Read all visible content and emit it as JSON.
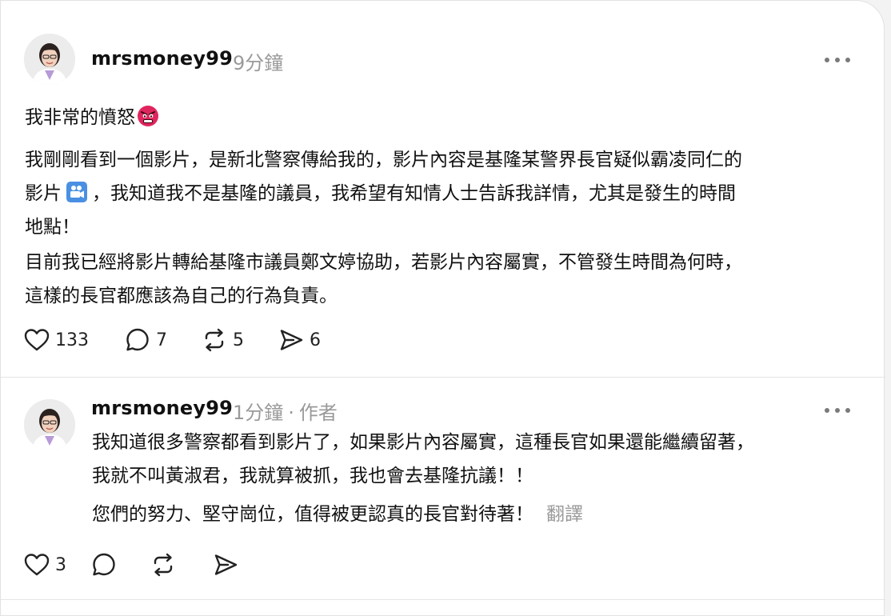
{
  "posts": [
    {
      "username": "mrsmoney99",
      "time": "9分鐘",
      "paragraphs": [
        "我非常的憤怒",
        "我剛剛看到一個影片，是新北警察傳給我的，影片內容是基隆某警界長官疑似霸凌同仁的",
        "影片",
        "，我知道我不是基隆的議員，我希望有知情人士告訴我詳情，尤其是發生的時間",
        "地點！",
        "目前我已經將影片轉給基隆市議員鄭文婷協助，若影片內容屬實，不管發生時間為何時，",
        "這樣的長官都應該為自己的行為負責。"
      ],
      "likes": "133",
      "replies": "7",
      "reposts": "5",
      "shares": "6"
    },
    {
      "username": "mrsmoney99",
      "time": "1分鐘",
      "separator": "·",
      "author_badge": "作者",
      "paragraphs": [
        "我知道很多警察都看到影片了，如果影片內容屬實，這種長官如果還能繼續留著，",
        "我就不叫黃淑君，我就算被抓，我也會去基隆抗議！！",
        "您們的努力、堅守崗位，值得被更認真的長官對待著！"
      ],
      "translate_label": "翻譯",
      "likes": "3"
    }
  ],
  "icons": {
    "angry_emoji": "angry-face-emoji",
    "camera_emoji": "movie-camera-emoji",
    "like": "heart-icon",
    "reply": "speech-bubble-icon",
    "repost": "repost-icon",
    "share": "send-icon",
    "more": "more-dots-icon"
  },
  "colors": {
    "text": "#111111",
    "muted": "#9a9a9a",
    "divider": "#e4e4e4",
    "angry_emoji": "#e0245e",
    "camera_emoji": "#4a90e2"
  }
}
